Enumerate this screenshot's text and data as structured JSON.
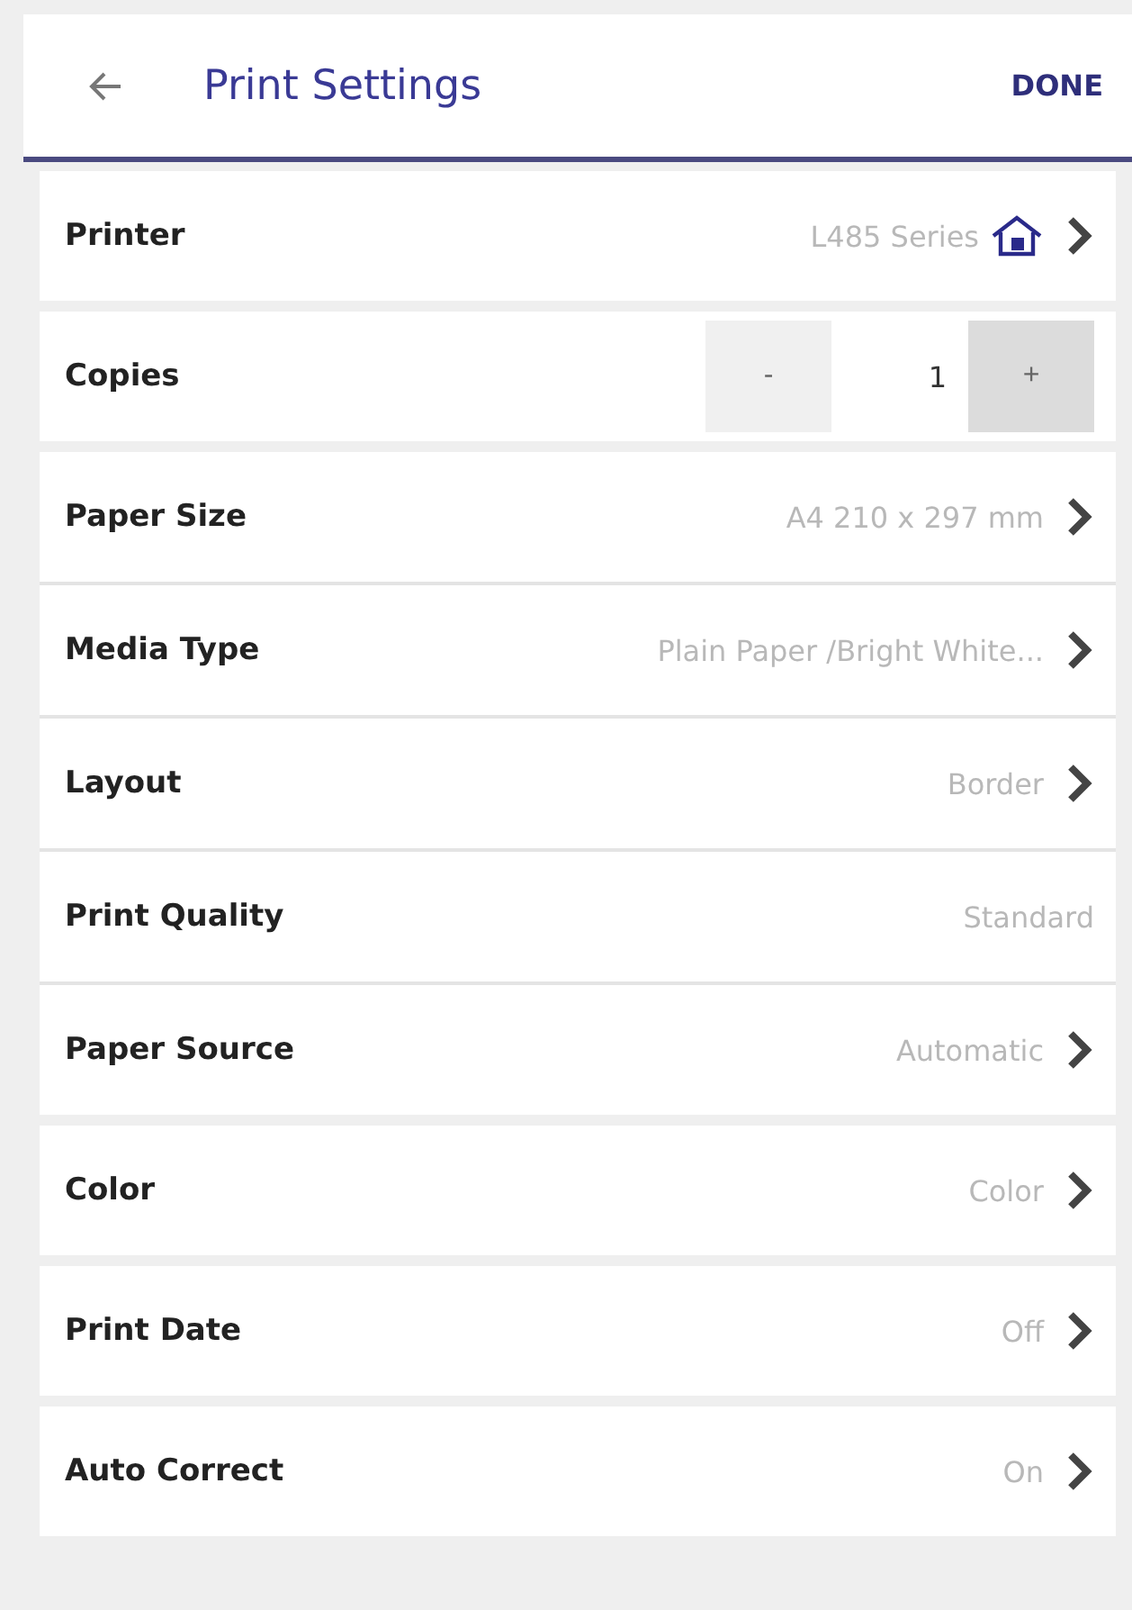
{
  "header": {
    "title": "Print Settings",
    "done": "DONE"
  },
  "groups": [
    [
      {
        "kind": "printer",
        "label": "Printer",
        "value": "L485 Series"
      }
    ],
    [
      {
        "kind": "stepper",
        "label": "Copies",
        "minus": "-",
        "value": "1",
        "plus": "+"
      }
    ],
    [
      {
        "kind": "link",
        "label": "Paper Size",
        "value": "A4 210 x 297 mm"
      },
      {
        "kind": "link",
        "label": "Media Type",
        "value": "Plain Paper /Bright White..."
      },
      {
        "kind": "link",
        "label": "Layout",
        "value": "Border"
      },
      {
        "kind": "plain",
        "label": "Print Quality",
        "value": "Standard"
      },
      {
        "kind": "link",
        "label": "Paper Source",
        "value": "Automatic"
      }
    ],
    [
      {
        "kind": "link",
        "label": "Color",
        "value": "Color"
      }
    ],
    [
      {
        "kind": "link",
        "label": "Print Date",
        "value": "Off"
      }
    ],
    [
      {
        "kind": "link",
        "label": "Auto Correct",
        "value": "On"
      }
    ]
  ]
}
